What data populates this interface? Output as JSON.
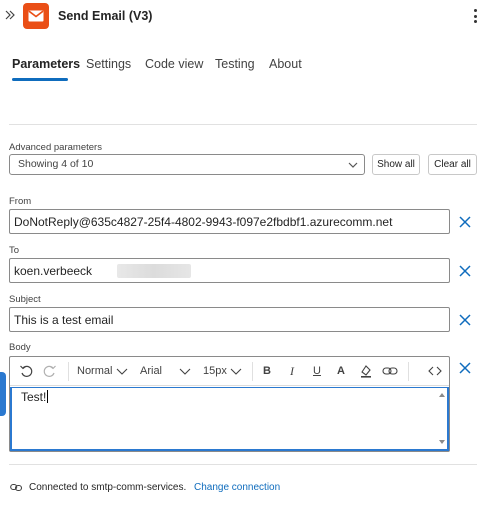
{
  "header": {
    "title": "Send Email (V3)",
    "collapse_icon": "double-chevron-right-icon",
    "app_icon": "email-envelope-icon",
    "app_color": "#ea4f16",
    "more_icon": "more-vertical-icon"
  },
  "tabs": [
    {
      "label": "Parameters",
      "active": true
    },
    {
      "label": "Settings",
      "active": false
    },
    {
      "label": "Code view",
      "active": false
    },
    {
      "label": "Testing",
      "active": false
    },
    {
      "label": "About",
      "active": false
    }
  ],
  "advanced": {
    "label": "Advanced parameters",
    "selected": "Showing 4 of 10",
    "show_all": "Show all",
    "clear_all": "Clear all"
  },
  "fields": {
    "from": {
      "label": "From",
      "value": "DoNotReply@635c4827-25f4-4802-9943-f097e2fbdbf1.azurecomm.net"
    },
    "to": {
      "label": "To",
      "value": "koen.verbeeck"
    },
    "subject": {
      "label": "Subject",
      "value": "This is a test email"
    },
    "body": {
      "label": "Body",
      "value": "Test!"
    }
  },
  "toolbar": {
    "format": "Normal",
    "font": "Arial",
    "size": "15px",
    "bold": "B",
    "italic": "I",
    "underline": "U",
    "font_color": "A"
  },
  "footer": {
    "connection_text": "Connected to smtp-comm-services.",
    "change_link": "Change connection"
  },
  "colors": {
    "accent": "#0f6cbd",
    "focus": "#2b79d0"
  }
}
